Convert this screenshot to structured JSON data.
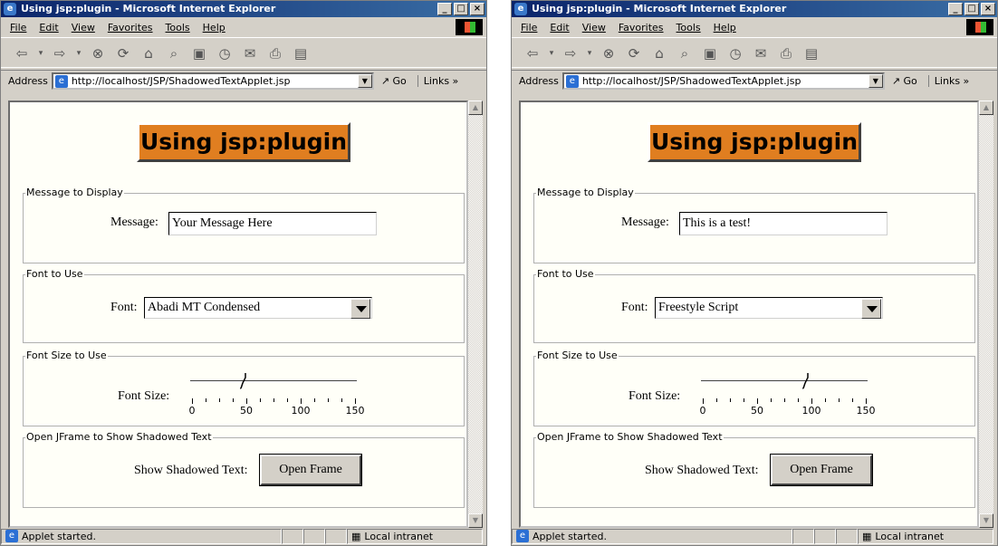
{
  "windows": [
    {
      "title": "Using jsp:plugin - Microsoft Internet Explorer",
      "menu": [
        "File",
        "Edit",
        "View",
        "Favorites",
        "Tools",
        "Help"
      ],
      "address_label": "Address",
      "url": "http://localhost/JSP/ShadowedTextApplet.jsp",
      "go_label": "Go",
      "links_label": "Links »",
      "page_heading": "Using jsp:plugin",
      "message_section": {
        "legend": "Message to Display",
        "label": "Message:",
        "value": "Your Message Here"
      },
      "font_section": {
        "legend": "Font to Use",
        "label": "Font:",
        "selected": "Abadi MT Condensed"
      },
      "size_section": {
        "legend": "Font Size to Use",
        "label": "Font Size:",
        "value": 48,
        "min": 0,
        "max": 150,
        "ticks": [
          "0",
          "50",
          "100",
          "150"
        ]
      },
      "frame_section": {
        "legend": "Open JFrame to Show Shadowed Text",
        "label": "Show Shadowed Text:",
        "button": "Open Frame"
      },
      "status": {
        "text": "Applet started.",
        "zone": "Local intranet"
      }
    },
    {
      "title": "Using jsp:plugin - Microsoft Internet Explorer",
      "menu": [
        "File",
        "Edit",
        "View",
        "Favorites",
        "Tools",
        "Help"
      ],
      "address_label": "Address",
      "url": "http://localhost/JSP/ShadowedTextApplet.jsp",
      "go_label": "Go",
      "links_label": "Links »",
      "page_heading": "Using jsp:plugin",
      "message_section": {
        "legend": "Message to Display",
        "label": "Message:",
        "value": "This is a test!"
      },
      "font_section": {
        "legend": "Font to Use",
        "label": "Font:",
        "selected": "Freestyle Script"
      },
      "size_section": {
        "legend": "Font Size to Use",
        "label": "Font Size:",
        "value": 96,
        "min": 0,
        "max": 150,
        "ticks": [
          "0",
          "50",
          "100",
          "150"
        ]
      },
      "frame_section": {
        "legend": "Open JFrame to Show Shadowed Text",
        "label": "Show Shadowed Text:",
        "button": "Open Frame"
      },
      "status": {
        "text": "Applet started.",
        "zone": "Local intranet"
      }
    }
  ]
}
